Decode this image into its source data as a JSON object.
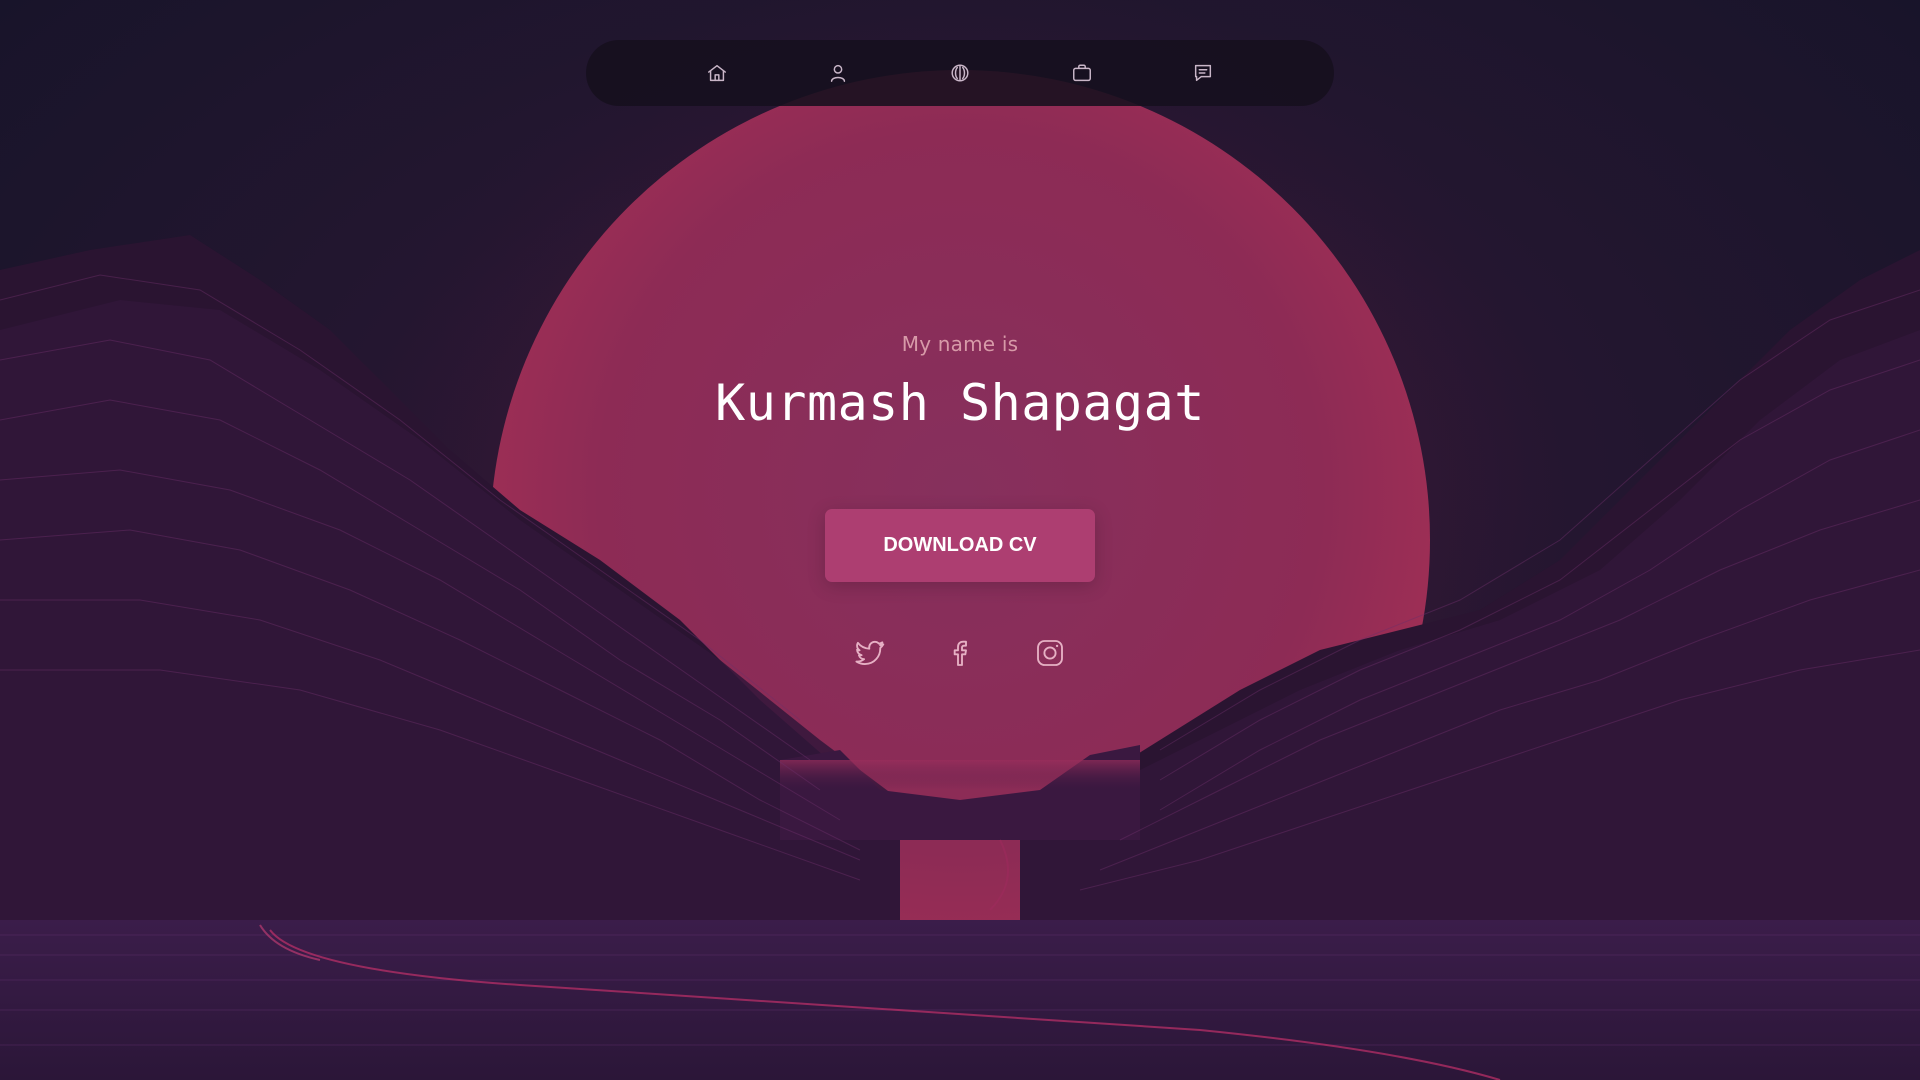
{
  "theme": {
    "sun_color": "#8f2b54",
    "accent": "#ad3e71",
    "background": "#1a1530",
    "nav_icon_color": "#c9b6c8"
  },
  "nav": {
    "items": [
      {
        "icon": "home-icon"
      },
      {
        "icon": "user-icon"
      },
      {
        "icon": "services-icon"
      },
      {
        "icon": "briefcase-icon"
      },
      {
        "icon": "message-icon"
      }
    ]
  },
  "hero": {
    "intro": "My name is",
    "name": "Kurmash Shapagat",
    "cv_button": "DOWNLOAD CV"
  },
  "socials": [
    {
      "icon": "twitter-icon"
    },
    {
      "icon": "facebook-icon"
    },
    {
      "icon": "instagram-icon"
    }
  ]
}
